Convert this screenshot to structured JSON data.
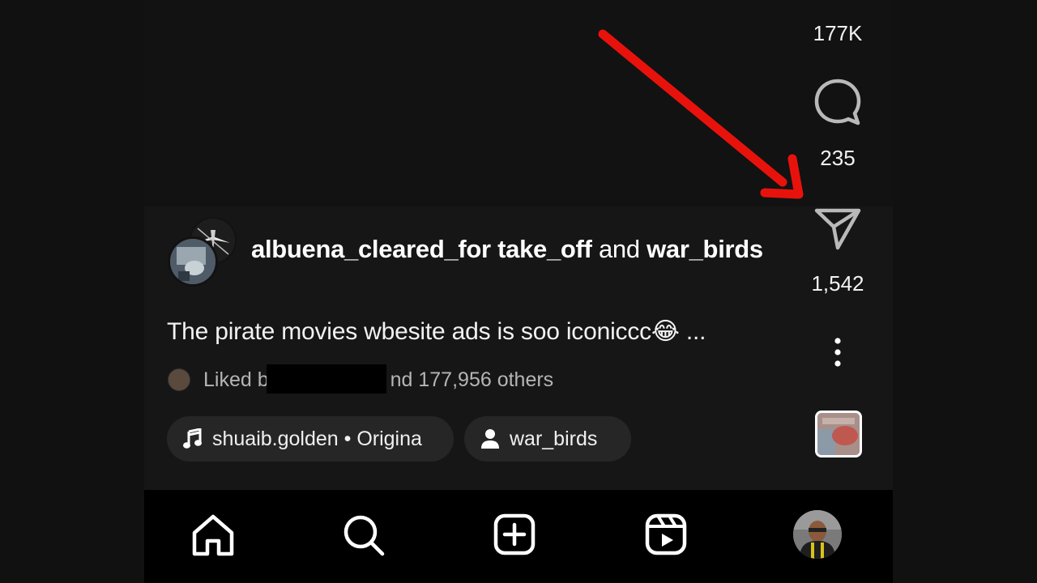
{
  "rail": {
    "likes_count": "177K",
    "comments_count": "235",
    "shares_count": "1,542"
  },
  "post": {
    "author_primary": "albuena_cleared_for take_off",
    "author_joiner": "and",
    "author_secondary": "war_birds",
    "caption": "The pirate movies wbesite ads is soo iconiccc😂 ...",
    "liked_prefix": "Liked b",
    "liked_suffix": "nd 177,956 others"
  },
  "pills": {
    "audio_label": "shuaib.golden • Origina",
    "collab_label": "war_birds"
  },
  "icons": {
    "comment": "comment-bubble-icon",
    "share": "send-paper-plane-icon",
    "more": "more-vertical-icon",
    "home": "home-icon",
    "search": "search-icon",
    "create": "add-square-icon",
    "reels": "reels-icon",
    "music": "music-note-icon",
    "person": "person-icon"
  },
  "colors": {
    "annotation_arrow": "#e8120c",
    "background": "#121212",
    "navbar": "#000000"
  }
}
